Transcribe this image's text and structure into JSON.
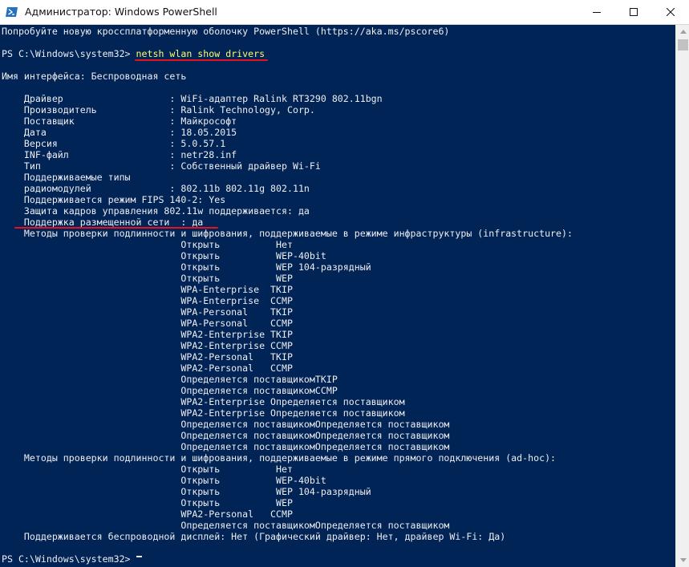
{
  "window": {
    "title": "Администратор: Windows PowerShell",
    "app_icon": "powershell-icon",
    "controls": [
      "minimize-icon",
      "maximize-icon",
      "close-icon"
    ]
  },
  "colors": {
    "console_background": "#012456",
    "console_text": "#eeedf0",
    "command_text": "#fefb6c",
    "highlight_underline": "#e81123"
  },
  "console": {
    "lines": [
      "Попробуйте новую кроссплатформенную оболочку PowerShell (https://aka.ms/pscore6)",
      "",
      "PS C:\\Windows\\system32> netsh wlan show drivers",
      "",
      "Имя интерфейса: Беспроводная сеть",
      "",
      "    Драйвер                   : WiFi-адаптер Ralink RT3290 802.11bgn",
      "    Производитель             : Ralink Technology, Corp.",
      "    Поставщик                 : Майкрософт",
      "    Дата                      : 18.05.2015",
      "    Версия                    : 5.0.57.1",
      "    INF-файл                  : netr28.inf",
      "    Тип                       : Собственный драйвер Wi-Fi",
      "    Поддерживаемые типы",
      "    радиомодулей              : 802.11b 802.11g 802.11n",
      "    Поддерживается режим FIPS 140-2: Yes",
      "    Защита кадров управления 802.11w поддерживается: да",
      "    Поддержка размещенной сети  : да",
      "    Методы проверки подлинности и шифрования, поддерживаемые в режиме инфраструктуры (infrastructure):",
      "                                Открыть          Нет",
      "                                Открыть          WEP-40bit",
      "                                Открыть          WEP 104-разрядный",
      "                                Открыть          WEP",
      "                                WPA-Enterprise  TKIP",
      "                                WPA-Enterprise  CCMP",
      "                                WPA-Personal    TKIP",
      "                                WPA-Personal    CCMP",
      "                                WPA2-Enterprise TKIP",
      "                                WPA2-Enterprise CCMP",
      "                                WPA2-Personal   TKIP",
      "                                WPA2-Personal   CCMP",
      "                                Определяется поставщикомTKIP",
      "                                Определяется поставщикомCCMP",
      "                                WPA2-Enterprise Определяется поставщиком",
      "                                WPA2-Enterprise Определяется поставщиком",
      "                                Определяется поставщикомОпределяется поставщиком",
      "                                Определяется поставщикомОпределяется поставщиком",
      "                                Определяется поставщикомОпределяется поставщиком",
      "    Методы проверки подлинности и шифрования, поддерживаемые в режиме прямого подключения (ad-hoc):",
      "                                Открыть          Нет",
      "                                Открыть          WEP-40bit",
      "                                Открыть          WEP 104-разрядный",
      "                                Открыть          WEP",
      "                                WPA2-Personal   CCMP",
      "                                Определяется поставщикомОпределяется поставщиком",
      "    Поддерживается беспроводной дисплей: Нет (Графический драйвер: Нет, драйвер Wi-Fi: Да)",
      "",
      "PS C:\\Windows\\system32> "
    ]
  }
}
